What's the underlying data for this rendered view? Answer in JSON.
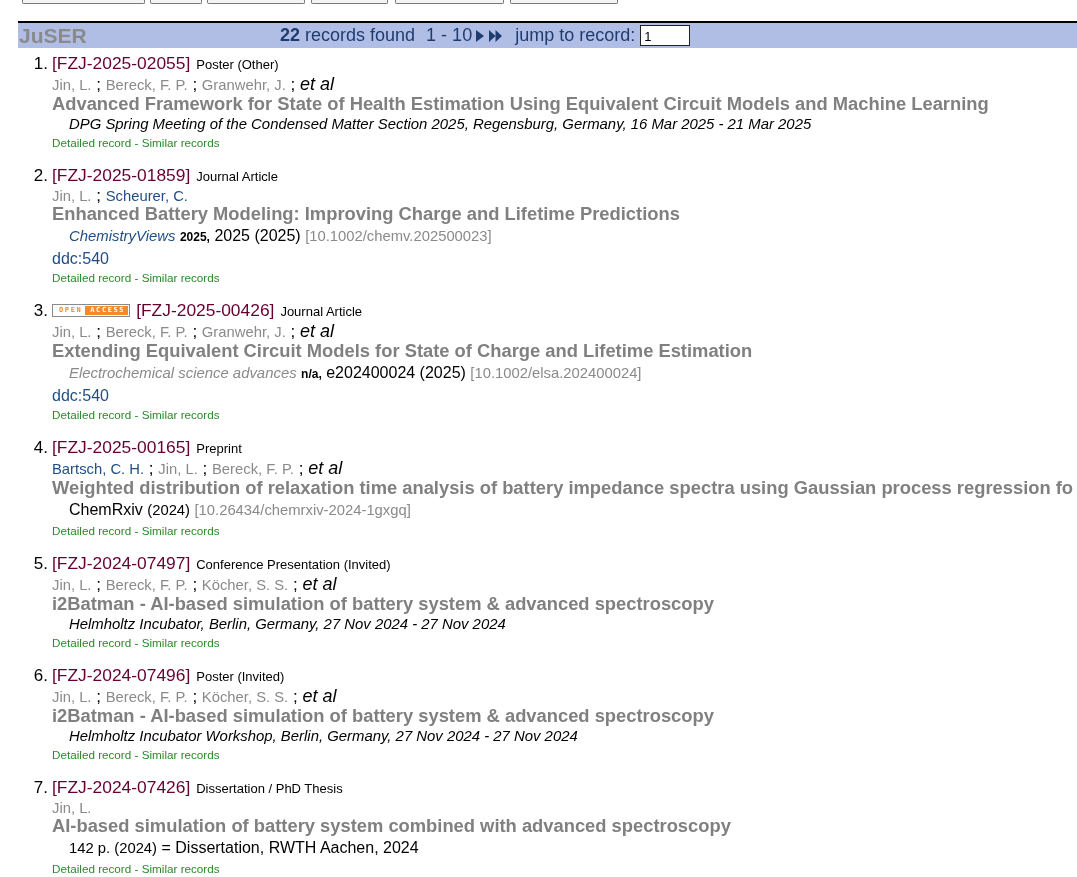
{
  "header": {
    "site_name": "JuSER",
    "count": "22",
    "count_label": "records found",
    "range": "1 - 10",
    "jump_label": "jump to record:",
    "jump_value": "1"
  },
  "records": [
    {
      "number": "1.",
      "id": "[FZJ-2025-02055]",
      "type": "Poster (Other)",
      "authors": [
        {
          "name": "Jin, L.",
          "visited": true,
          "separator": ";"
        },
        {
          "name": "Bereck, F. P.",
          "visited": true,
          "separator": ";"
        },
        {
          "name": "Granwehr, J.",
          "visited": true,
          "separator": ";"
        }
      ],
      "et_al": "et al",
      "title": "Advanced Framework for State of Health Estimation Using Equivalent Circuit Models and Machine Learning",
      "citation": [
        {
          "kind": "event",
          "text": "DPG Spring Meeting of the Condensed Matter Section 2025, Regensburg, Germany, 16 Mar 2025 - 21 Mar 2025"
        }
      ],
      "links": [
        {
          "label": "Detailed record",
          "separator": "-"
        },
        {
          "label": "Similar records"
        }
      ]
    },
    {
      "number": "2.",
      "id": "[FZJ-2025-01859]",
      "type": "Journal Article",
      "authors": [
        {
          "name": "Jin, L.",
          "visited": true,
          "separator": ";"
        },
        {
          "name": "Scheurer, C.",
          "visited": false
        }
      ],
      "title": "Enhanced Battery Modeling: Improving Charge and Lifetime Predictions",
      "citation": [
        {
          "kind": "journal",
          "text": "ChemistryViews",
          "visited": false
        },
        {
          "kind": "volume",
          "text": "2025,"
        },
        {
          "kind": "pages",
          "text": "2025 (2025)"
        },
        {
          "kind": "doi",
          "text": "[10.1002/chemv.202500023]"
        }
      ],
      "classification": "ddc:540",
      "links": [
        {
          "label": "Detailed record",
          "separator": "-"
        },
        {
          "label": "Similar records"
        }
      ]
    },
    {
      "number": "3.",
      "badge": {
        "words": [
          "OPEN",
          "ACCESS"
        ]
      },
      "id": "[FZJ-2025-00426]",
      "type": "Journal Article",
      "authors": [
        {
          "name": "Jin, L.",
          "visited": true,
          "separator": ";"
        },
        {
          "name": "Bereck, F. P.",
          "visited": true,
          "separator": ";"
        },
        {
          "name": "Granwehr, J.",
          "visited": true,
          "separator": ";"
        }
      ],
      "et_al": "et al",
      "title": "Extending Equivalent Circuit Models for State of Charge and Lifetime Estimation",
      "citation": [
        {
          "kind": "journal",
          "text": "Electrochemical science advances",
          "visited": true
        },
        {
          "kind": "volume",
          "text": "n/a,"
        },
        {
          "kind": "pages",
          "text": "e202400024 (2025)"
        },
        {
          "kind": "doi",
          "text": "[10.1002/elsa.202400024]"
        }
      ],
      "classification": "ddc:540",
      "links": [
        {
          "label": "Detailed record",
          "separator": "-"
        },
        {
          "label": "Similar records"
        }
      ]
    },
    {
      "number": "4.",
      "id": "[FZJ-2025-00165]",
      "type": "Preprint",
      "authors": [
        {
          "name": "Bartsch, C. H.",
          "visited": false,
          "separator": ";"
        },
        {
          "name": "Jin, L.",
          "visited": true,
          "separator": ";"
        },
        {
          "name": "Bereck, F. P.",
          "visited": true,
          "separator": ";"
        }
      ],
      "et_al": "et al",
      "title": "Weighted distribution of relaxation time analysis of battery impedance spectra using Gaussian process regression fo",
      "citation": [
        {
          "kind": "source",
          "text": "ChemRxiv"
        },
        {
          "kind": "year",
          "text": "(2024)"
        },
        {
          "kind": "doi",
          "text": "[10.26434/chemrxiv-2024-1gxgq]"
        }
      ],
      "links": [
        {
          "label": "Detailed record",
          "separator": "-"
        },
        {
          "label": "Similar records"
        }
      ]
    },
    {
      "number": "5.",
      "id": "[FZJ-2024-07497]",
      "type": "Conference Presentation (Invited)",
      "authors": [
        {
          "name": "Jin, L.",
          "visited": true,
          "separator": ";"
        },
        {
          "name": "Bereck, F. P.",
          "visited": true,
          "separator": ";"
        },
        {
          "name": "Köcher, S. S.",
          "visited": true,
          "separator": ";"
        }
      ],
      "et_al": "et al",
      "title": "i2Batman - AI-based simulation of battery system & advanced spectroscopy",
      "citation": [
        {
          "kind": "event",
          "text": "Helmholtz Incubator, Berlin, Germany, 27 Nov 2024 - 27 Nov 2024"
        }
      ],
      "links": [
        {
          "label": "Detailed record",
          "separator": "-"
        },
        {
          "label": "Similar records"
        }
      ]
    },
    {
      "number": "6.",
      "id": "[FZJ-2024-07496]",
      "type": "Poster (Invited)",
      "authors": [
        {
          "name": "Jin, L.",
          "visited": true,
          "separator": ";"
        },
        {
          "name": "Bereck, F. P.",
          "visited": true,
          "separator": ";"
        },
        {
          "name": "Köcher, S. S.",
          "visited": true,
          "separator": ";"
        }
      ],
      "et_al": "et al",
      "title": "i2Batman - AI-based simulation of battery system & advanced spectroscopy",
      "citation": [
        {
          "kind": "event",
          "text": "Helmholtz Incubator Workshop, Berlin, Germany, 27 Nov 2024 - 27 Nov 2024"
        }
      ],
      "links": [
        {
          "label": "Detailed record",
          "separator": "-"
        },
        {
          "label": "Similar records"
        }
      ]
    },
    {
      "number": "7.",
      "id": "[FZJ-2024-07426]",
      "type": "Dissertation / PhD Thesis",
      "authors": [
        {
          "name": "Jin, L.",
          "visited": true
        }
      ],
      "title": "AI-based simulation of battery system combined with advanced spectroscopy",
      "citation": [
        {
          "kind": "extent",
          "text": "142 p. (2024)"
        },
        {
          "kind": "note",
          "text": "= Dissertation, RWTH Aachen, 2024"
        }
      ],
      "links": [
        {
          "label": "Detailed record",
          "separator": "-"
        },
        {
          "label": "Similar records"
        }
      ]
    }
  ]
}
